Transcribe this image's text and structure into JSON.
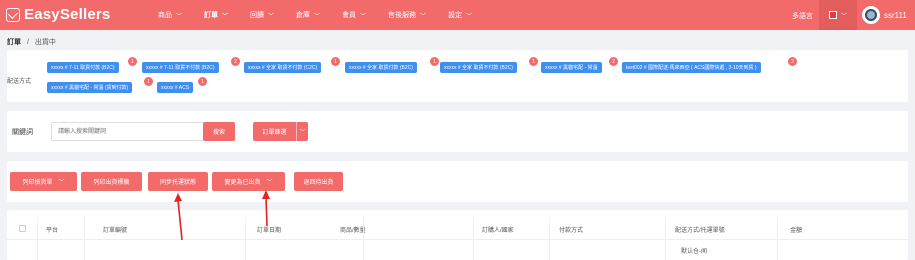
{
  "header": {
    "logo": "EasySellers",
    "nav": [
      "商品",
      "訂單",
      "回饋",
      "倉庫",
      "會員",
      "售後服務",
      "設定"
    ],
    "language": "多語言",
    "username": "ssr111"
  },
  "breadcrumb": {
    "root": "訂單",
    "separator": "/",
    "current": "出貨中"
  },
  "shipping": {
    "label": "配送方式",
    "chips": [
      {
        "text": "xxxxx # 7-11 取貨付款 (B2C)",
        "badge": "1"
      },
      {
        "text": "xxxxx # 7-11 取貨不付款 (B2C)",
        "badge": "2"
      },
      {
        "text": "xxxxx # 全家 取貨不付款 (C2C)",
        "badge": "1"
      },
      {
        "text": "xxxxx # 全家 取貨付款 (B2C)",
        "badge": "1"
      },
      {
        "text": "xxxxx # 全家 取貨不付款 (B2C)",
        "badge": "1"
      },
      {
        "text": "xxxxx # 黑貓宅配 - 常溫",
        "badge": "2"
      },
      {
        "text": "test002 # 國際配送-馬來西亞 ( ACS國際快遞 , 3-10天到貨 )",
        "badge": "2"
      },
      {
        "text": "xxxxx # 黑貓宅配 - 常溫 (貨到付款)",
        "badge": "1"
      },
      {
        "text": "xxxxx # ACS",
        "badge": "1"
      }
    ]
  },
  "search": {
    "label": "關鍵詞",
    "placeholder": "請輸入搜索關鍵詞",
    "search_button": "搜索",
    "filter_button": "訂單篩選"
  },
  "actions": {
    "print_picking": "列印撿貨單",
    "print_shipping": "列印出貨標籤",
    "sync_logistics": "同步托運狀態",
    "change_status": "變更為已出貨",
    "return_to_pending": "退回待出貨"
  },
  "table": {
    "headers": [
      "平台",
      "訂單編號",
      "訂單日期",
      "商品/數量",
      "訂購人/國家",
      "付款方式",
      "配送方式/托運單號",
      "金額"
    ],
    "first_row_text": "默认仓-闻"
  },
  "colors": {
    "accent": "#f26a6a",
    "chip": "#3f8ff0"
  }
}
